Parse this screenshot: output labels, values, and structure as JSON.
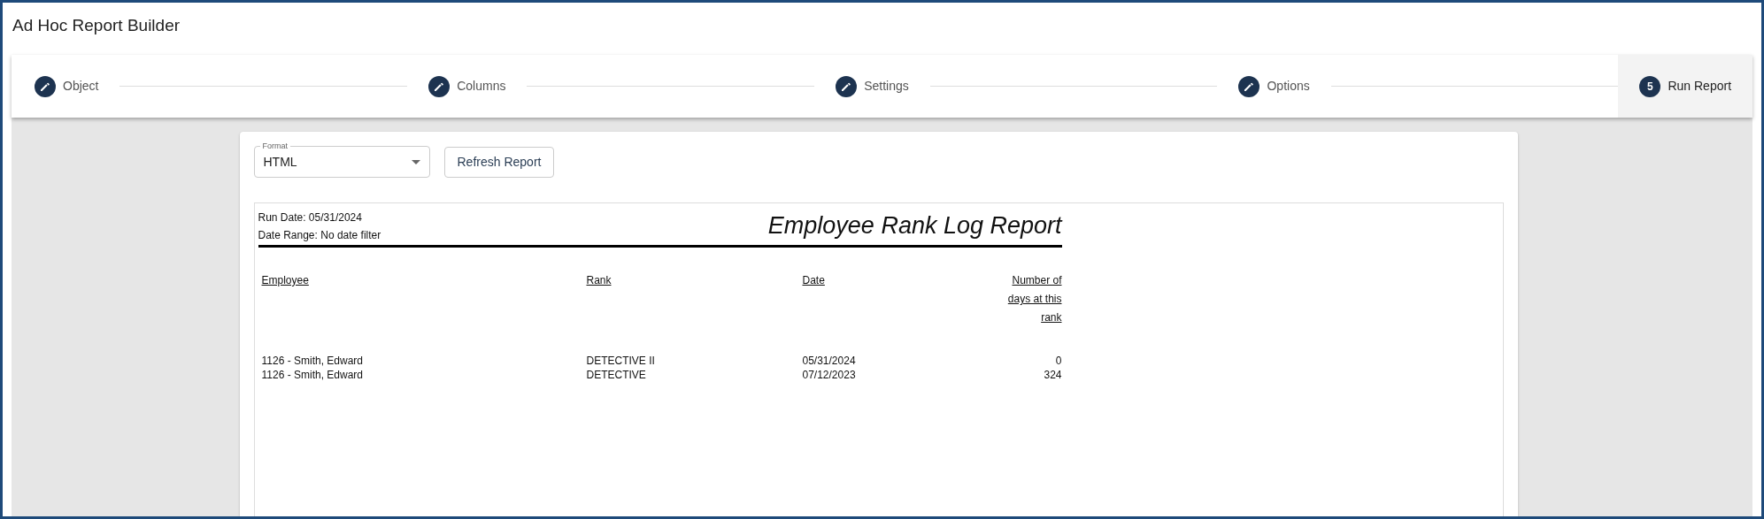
{
  "window": {
    "title": "Ad Hoc Report Builder"
  },
  "steps": [
    {
      "label": "Object",
      "kind": "done",
      "selected": false
    },
    {
      "label": "Columns",
      "kind": "done",
      "selected": false
    },
    {
      "label": "Settings",
      "kind": "done",
      "selected": false
    },
    {
      "label": "Options",
      "kind": "done",
      "selected": false
    },
    {
      "label": "Run Report",
      "kind": "number",
      "number": "5",
      "selected": true
    }
  ],
  "format_select": {
    "label": "Format",
    "value": "HTML"
  },
  "refresh_button": "Refresh Report",
  "report": {
    "run_date": "Run Date: 05/31/2024",
    "date_range": "Date Range: No date filter",
    "title": "Employee Rank Log Report",
    "columns": [
      "Employee",
      "Rank",
      "Date",
      "Number of days at this rank"
    ],
    "rows": [
      [
        "1126 - Smith, Edward",
        "DETECTIVE II",
        "05/31/2024",
        "0"
      ],
      [
        "1126 - Smith, Edward",
        "DETECTIVE",
        "07/12/2023",
        "324"
      ]
    ]
  }
}
